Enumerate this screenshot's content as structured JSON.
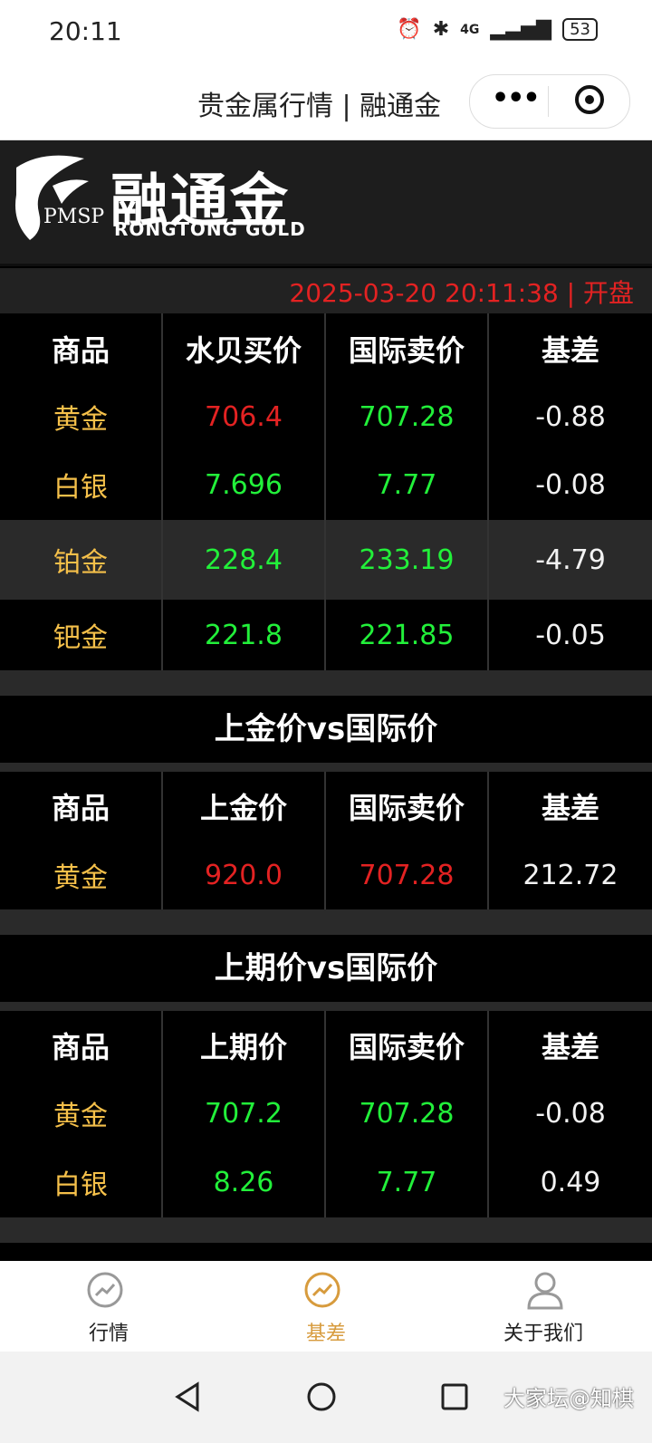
{
  "status": {
    "time": "20:11",
    "network": "4G",
    "battery": "53"
  },
  "titlebar": {
    "title": "贵金属行情 | 融通金"
  },
  "header": {
    "logo_cn": "融通金",
    "logo_en": "RONGTONG  GOLD",
    "logo_pmsp": "PMSP"
  },
  "timestamp": "2025-03-20 20:11:38 | 开盘",
  "table1": {
    "headers": [
      "商品",
      "水贝买价",
      "国际卖价",
      "基差"
    ],
    "rows": [
      [
        "黄金",
        "706.4",
        "707.28",
        "-0.88"
      ],
      [
        "白银",
        "7.696",
        "7.77",
        "-0.08"
      ],
      [
        "铂金",
        "228.4",
        "233.19",
        "-4.79"
      ],
      [
        "钯金",
        "221.8",
        "221.85",
        "-0.05"
      ]
    ]
  },
  "section2": {
    "title": "上金价vs国际价"
  },
  "table2": {
    "headers": [
      "商品",
      "上金价",
      "国际卖价",
      "基差"
    ],
    "rows": [
      [
        "黄金",
        "920.0",
        "707.28",
        "212.72"
      ]
    ]
  },
  "section3": {
    "title": "上期价vs国际价"
  },
  "table3": {
    "headers": [
      "商品",
      "上期价",
      "国际卖价",
      "基差"
    ],
    "rows": [
      [
        "黄金",
        "707.2",
        "707.28",
        "-0.08"
      ],
      [
        "白银",
        "8.26",
        "7.77",
        "0.49"
      ]
    ]
  },
  "tabs": [
    {
      "label": "行情"
    },
    {
      "label": "基差"
    },
    {
      "label": "关于我们"
    }
  ],
  "watermark": "大家坛@知棋",
  "colors": {
    "gold": "#f5c04a",
    "red": "#e32222",
    "green": "#22f03a",
    "accent": "#d79b3d"
  }
}
